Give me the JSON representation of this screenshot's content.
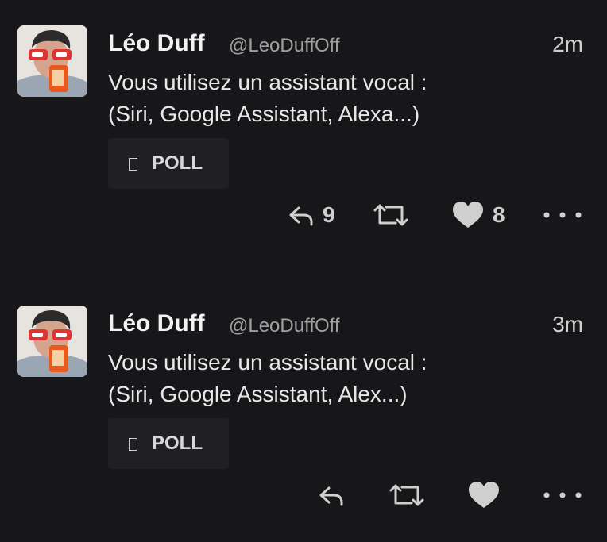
{
  "tweets": [
    {
      "author_name": "Léo Duff",
      "handle": "@LeoDuffOff",
      "time": "2m",
      "text_lines": [
        "Vous utilisez un assistant vocal :",
        "(Siri, Google Assistant, Alexa...)"
      ],
      "poll_label": "POLL",
      "reply_count": "9",
      "retweet_count": "",
      "like_count": "8"
    },
    {
      "author_name": "Léo Duff",
      "handle": "@LeoDuffOff",
      "time": "3m",
      "text_lines": [
        "Vous utilisez un assistant vocal :",
        "(Siri, Google Assistant, Alex...)"
      ],
      "poll_label": "POLL",
      "reply_count": "",
      "retweet_count": "",
      "like_count": ""
    }
  ],
  "icons": {
    "poll": "poll-icon",
    "reply": "reply-icon",
    "retweet": "retweet-icon",
    "like": "heart-icon",
    "more": "more-icon"
  },
  "colors": {
    "background": "#17171a",
    "text": "#e8e8e8",
    "secondary": "#a0a0a0",
    "card": "#202024"
  }
}
